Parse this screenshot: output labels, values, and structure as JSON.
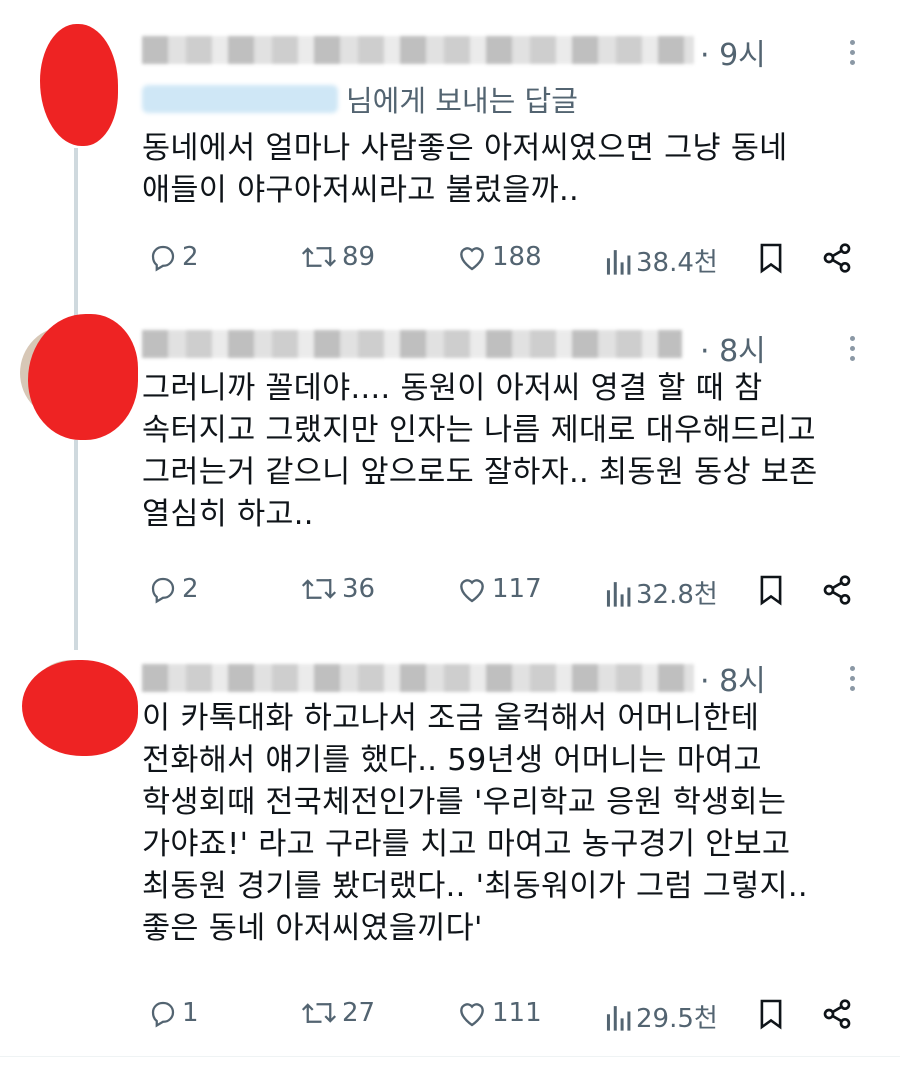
{
  "tweets": [
    {
      "time": "· 9시",
      "reply_to": "님에게 보내는 답글",
      "text": "동네에서 얼마나 사람좋은 아저씨였으면 그냥 동네\n애들이 야구아저씨라고 불렀을까..",
      "replies": "2",
      "retweets": "89",
      "likes": "188",
      "views": "38.4천"
    },
    {
      "time": "· 8시",
      "text": "그러니까 꼴데야.... 동원이 아저씨 영결 할 때 참\n속터지고 그랬지만 인자는 나름 제대로 대우해드리고\n그러는거 같으니 앞으로도 잘하자.. 최동원 동상 보존\n열심히 하고..",
      "replies": "2",
      "retweets": "36",
      "likes": "117",
      "views": "32.8천"
    },
    {
      "time": "· 8시",
      "text": "이 카톡대화 하고나서 조금 울컥해서 어머니한테\n전화해서 얘기를 했다.. 59년생 어머니는 마여고\n학생회때 전국체전인가를 '우리학교 응원 학생회는\n가야죠!' 라고 구라를 치고 마여고 농구경기 안보고\n최동원 경기를 봤더랬다.. '최동워이가 그럼 그렇지..\n좋은 동네 아저씨였을끼다'",
      "replies": "1",
      "retweets": "27",
      "likes": "111",
      "views": "29.5천"
    }
  ],
  "icons": {
    "reply": "reply-icon",
    "retweet": "retweet-icon",
    "like": "like-icon",
    "views": "views-icon",
    "bookmark": "bookmark-icon",
    "share": "share-icon",
    "more": "more-icon"
  },
  "colors": {
    "muted": "#536471",
    "text": "#0f1419",
    "redaction": "#ee2323"
  }
}
